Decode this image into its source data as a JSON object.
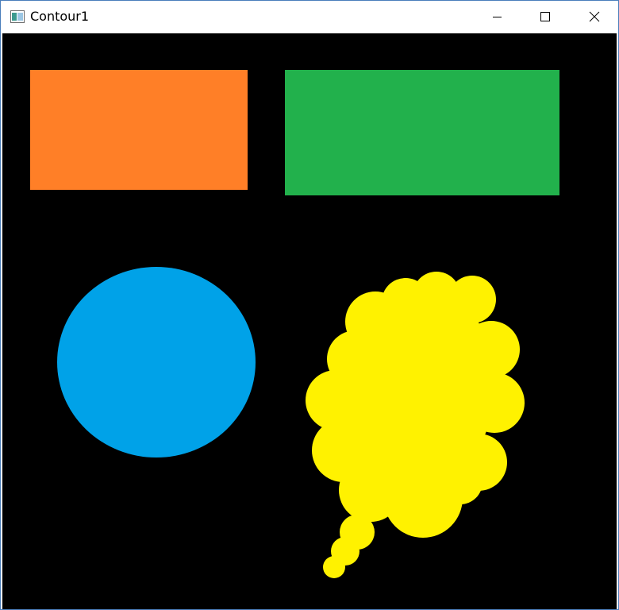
{
  "window": {
    "title": "Contour1",
    "app_icon": "image-window-icon",
    "controls": {
      "minimize_icon": "minimize-icon",
      "maximize_icon": "maximize-icon",
      "close_icon": "close-icon"
    }
  },
  "canvas": {
    "background": "#000000",
    "shapes": [
      {
        "name": "orange-rectangle",
        "kind": "rectangle",
        "color": "#FF7F27"
      },
      {
        "name": "green-rectangle",
        "kind": "rectangle",
        "color": "#22B14C"
      },
      {
        "name": "blue-ellipse",
        "kind": "ellipse",
        "color": "#00A2E8"
      },
      {
        "name": "yellow-blob",
        "kind": "freeform",
        "color": "#FFF200"
      }
    ]
  }
}
